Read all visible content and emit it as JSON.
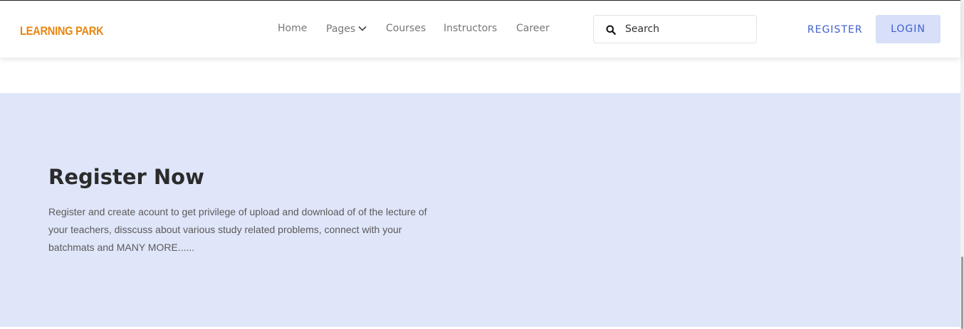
{
  "header": {
    "logo_text": "LEARNING PARK",
    "nav": {
      "home": "Home",
      "pages": "Pages",
      "courses": "Courses",
      "instructors": "Instructors",
      "career": "Career"
    },
    "search": {
      "placeholder": "Search",
      "value": ""
    },
    "register_label": "REGISTER",
    "login_label": "LOGIN"
  },
  "hero": {
    "title": "Register Now",
    "description": "Register and create acount to get privilege of upload and download of of the lecture of your teachers, disscuss about various study related problems, connect with your batchmats and MANY MORE......"
  },
  "colors": {
    "logo": "#e8850f",
    "accent": "#3f5fcf",
    "login_bg": "#d7dff9",
    "hero_bg": "#e0e6f9"
  },
  "icons": {
    "search": "search-icon",
    "pages_dropdown": "chevron-down-icon"
  }
}
